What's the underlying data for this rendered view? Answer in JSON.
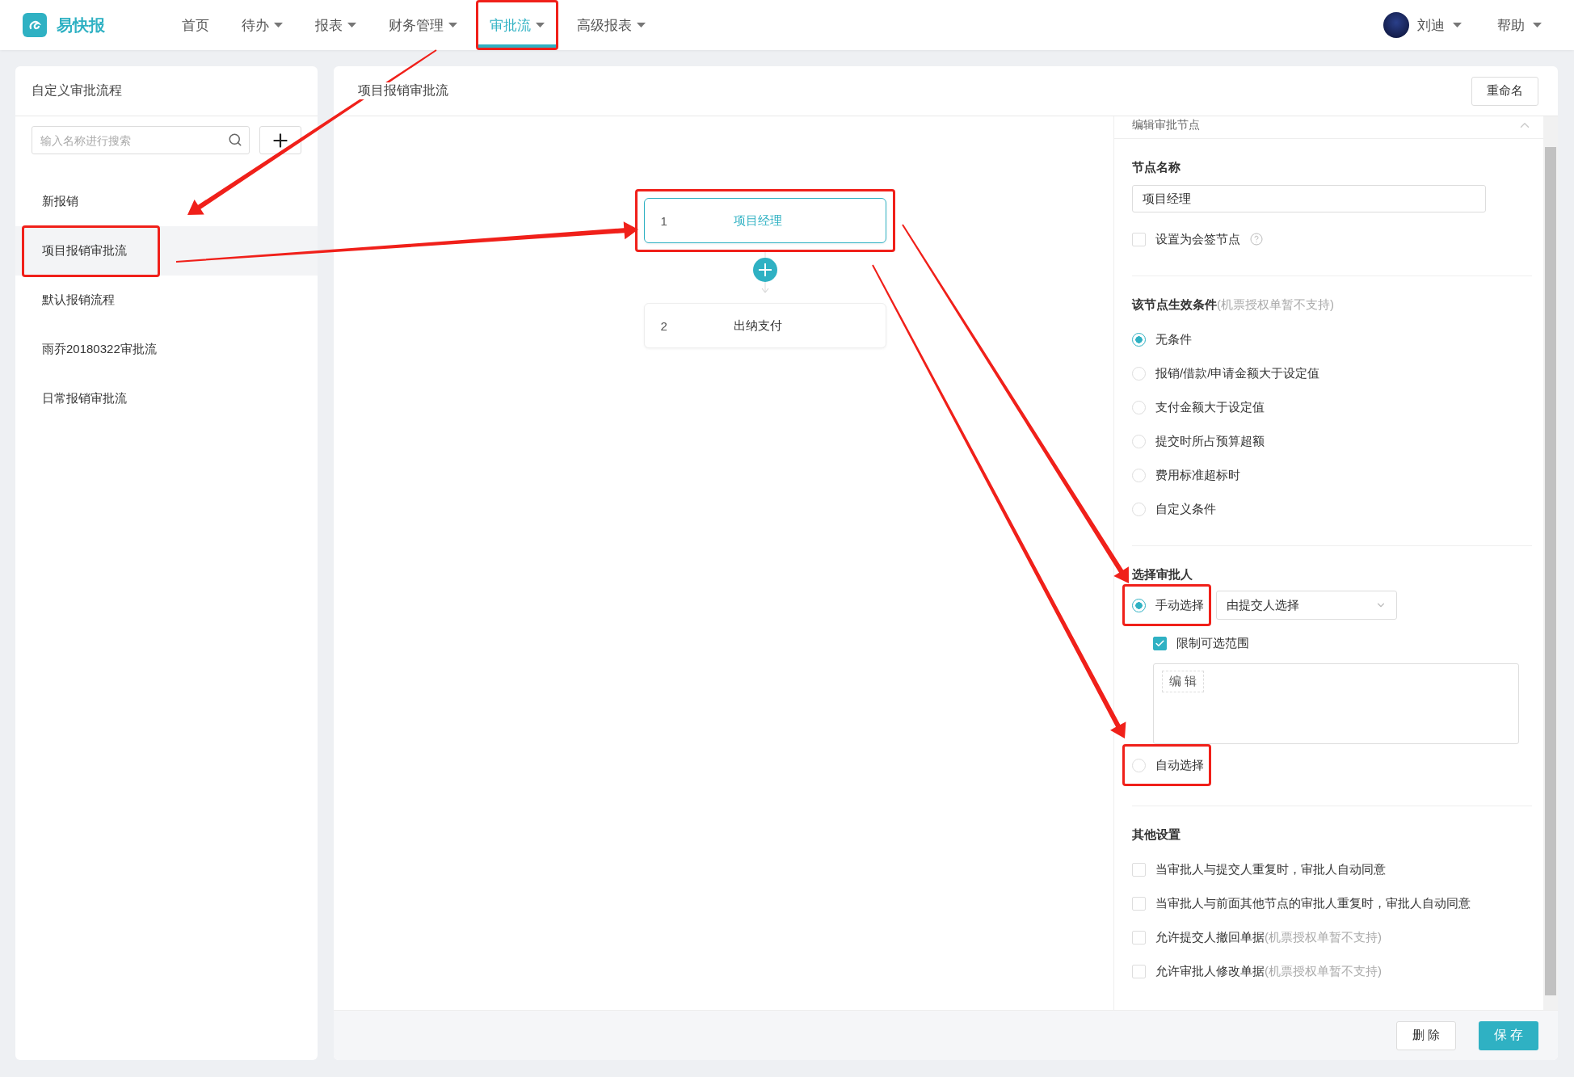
{
  "app": {
    "name": "易快报"
  },
  "nav": [
    {
      "label": "首页",
      "dropdown": false,
      "selected": false,
      "highlighted": false
    },
    {
      "label": "待办",
      "dropdown": true,
      "selected": false,
      "highlighted": false
    },
    {
      "label": "报表",
      "dropdown": true,
      "selected": false,
      "highlighted": false
    },
    {
      "label": "财务管理",
      "dropdown": true,
      "selected": false,
      "highlighted": false
    },
    {
      "label": "审批流",
      "dropdown": true,
      "selected": true,
      "highlighted": true
    },
    {
      "label": "高级报表",
      "dropdown": true,
      "selected": false,
      "highlighted": false
    }
  ],
  "user": {
    "name": "刘迪"
  },
  "help": {
    "label": "帮助"
  },
  "sidebar": {
    "title": "自定义审批流程",
    "search_placeholder": "输入名称进行搜索",
    "items": [
      {
        "label": "新报销",
        "selected": false,
        "highlighted": false
      },
      {
        "label": "项目报销审批流",
        "selected": true,
        "highlighted": true
      },
      {
        "label": "默认报销流程",
        "selected": false,
        "highlighted": false
      },
      {
        "label": "雨乔20180322审批流",
        "selected": false,
        "highlighted": false
      },
      {
        "label": "日常报销审批流",
        "selected": false,
        "highlighted": false
      }
    ]
  },
  "flow": {
    "title": "项目报销审批流",
    "rename_button": "重命名",
    "nodes": [
      {
        "number": "1",
        "name": "项目经理",
        "selected": true,
        "highlighted": true
      },
      {
        "number": "2",
        "name": "出纳支付",
        "selected": false,
        "highlighted": false
      }
    ]
  },
  "editor": {
    "title": "编辑审批节点",
    "node_name_label": "节点名称",
    "node_name_value": "项目经理",
    "countersign": {
      "label": "设置为会签节点",
      "checked": false
    },
    "conditions": {
      "title": "该节点生效条件",
      "note": "(机票授权单暂不支持)",
      "options": [
        {
          "label": "无条件",
          "selected": true
        },
        {
          "label": "报销/借款/申请金额大于设定值",
          "selected": false
        },
        {
          "label": "支付金额大于设定值",
          "selected": false
        },
        {
          "label": "提交时所占预算超额",
          "selected": false
        },
        {
          "label": "费用标准超标时",
          "selected": false
        },
        {
          "label": "自定义条件",
          "selected": false
        }
      ]
    },
    "approver": {
      "title": "选择审批人",
      "options": [
        {
          "kind": "manual",
          "label": "手动选择",
          "selected": true,
          "highlighted": true,
          "select_value": "由提交人选择",
          "limit_range": {
            "label": "限制可选范围",
            "checked": true
          },
          "edit_button": "编 辑"
        },
        {
          "kind": "auto",
          "label": "自动选择",
          "selected": false,
          "highlighted": true
        }
      ]
    },
    "other": {
      "title": "其他设置",
      "options": [
        {
          "label": "当审批人与提交人重复时，审批人自动同意",
          "checked": false
        },
        {
          "label": "当审批人与前面其他节点的审批人重复时，审批人自动同意",
          "checked": false
        },
        {
          "label": "允许提交人撤回单据",
          "note": "(机票授权单暂不支持)",
          "checked": false
        },
        {
          "label": "允许审批人修改单据",
          "note": "(机票授权单暂不支持)",
          "checked": false
        }
      ]
    }
  },
  "footer": {
    "delete_button": "删 除",
    "save_button": "保 存"
  }
}
